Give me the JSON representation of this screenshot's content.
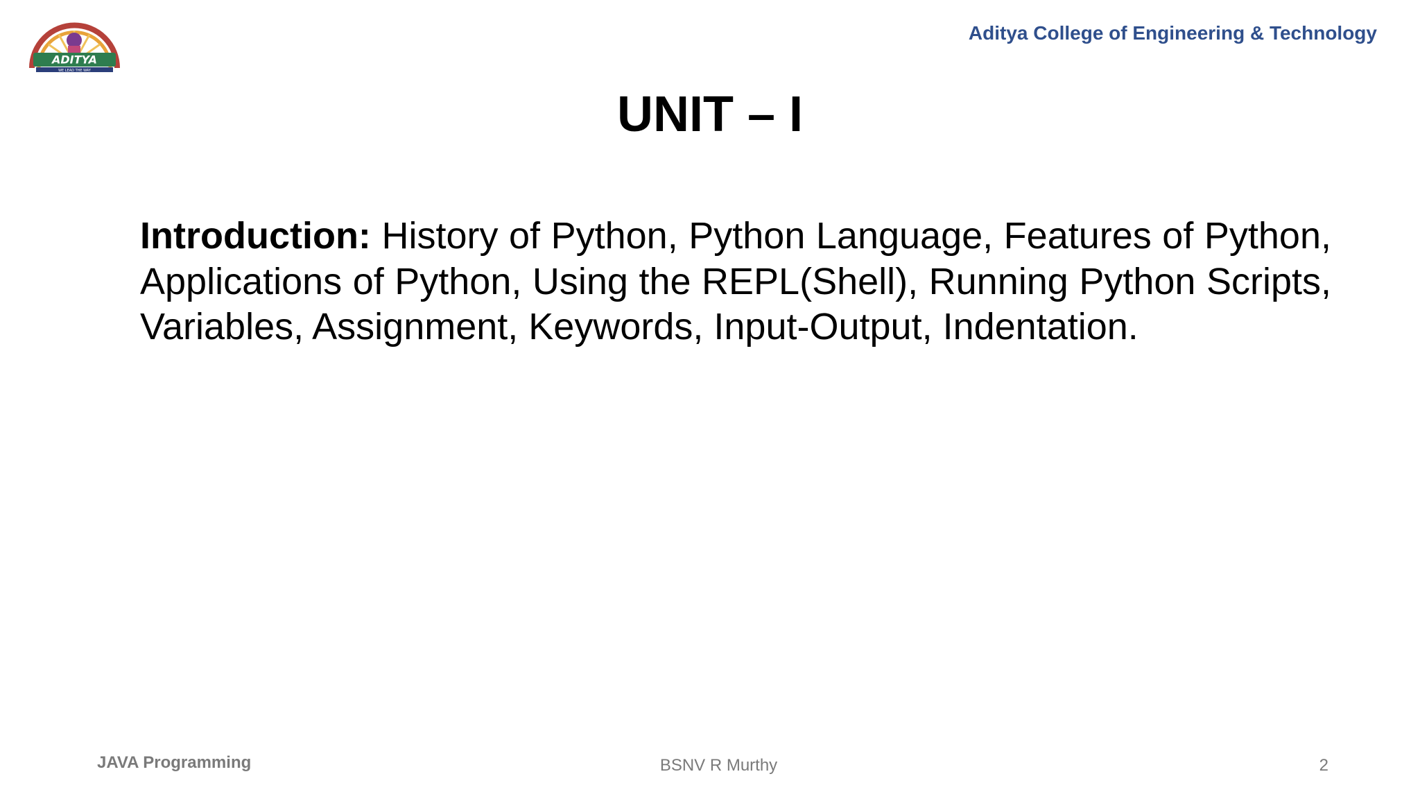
{
  "header": {
    "logo_text": "ADITYA",
    "logo_tagline": "WE LEAD THE WAY",
    "college_name": "Aditya College of Engineering & Technology"
  },
  "slide": {
    "title": "UNIT – I",
    "body_lead": "Introduction:",
    "body_text": "History of Python, Python Language, Features of Python, Applications of Python, Using the REPL(Shell), Running Python Scripts, Variables, Assignment, Keywords, Input-Output, Indentation."
  },
  "footer": {
    "course": "JAVA Programming",
    "author": "BSNV R Murthy",
    "slide_number": "2"
  },
  "colors": {
    "college_name": "#2f4f8c",
    "footer_text": "#7a7a7a",
    "logo_ring": "#b5413a",
    "logo_banner": "#2e7d4f"
  }
}
